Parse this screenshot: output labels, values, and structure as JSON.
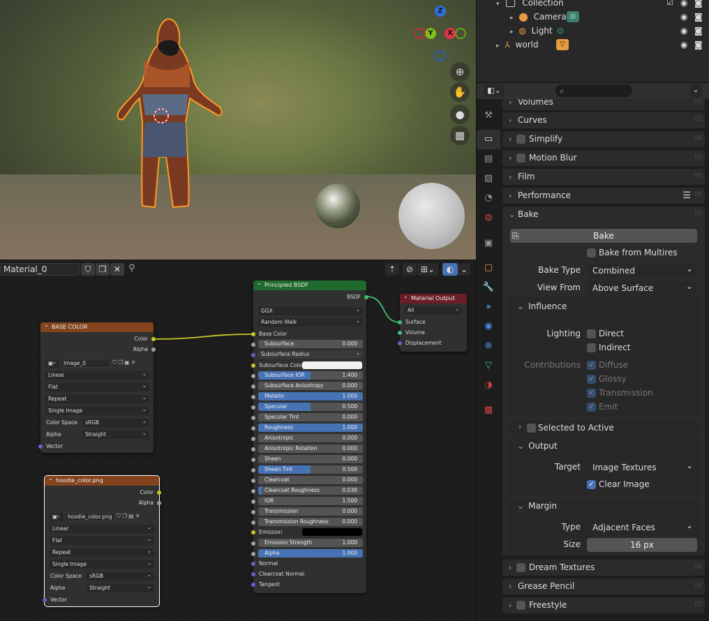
{
  "viewport": {
    "gizmo": {
      "z": "Z",
      "y": "Y",
      "x": "X"
    },
    "nav_icons": [
      "zoom-icon",
      "hand-icon",
      "camera-icon",
      "grid-icon"
    ]
  },
  "outliner": {
    "rows": [
      {
        "label": "Collection",
        "icon": "collection-icon"
      },
      {
        "label": "Camera",
        "icon": "camera-object-icon"
      },
      {
        "label": "Light",
        "icon": "light-object-icon"
      },
      {
        "label": "world",
        "icon": "world-object-icon"
      }
    ]
  },
  "node_editor": {
    "material_name": "Material_0",
    "nodes": {
      "base_color": {
        "title": "BASE COLOR",
        "out_color": "Color",
        "out_alpha": "Alpha",
        "image": "Image_0",
        "interp": "Linear",
        "proj": "Flat",
        "ext": "Repeat",
        "source": "Single Image",
        "cs_label": "Color Space",
        "cs_value": "sRGB",
        "alpha_label": "Alpha",
        "alpha_value": "Straight",
        "vector": "Vector"
      },
      "hoodie": {
        "title": "hoodie_color.png",
        "out_color": "Color",
        "out_alpha": "Alpha",
        "image": "hoodie_color.png",
        "interp": "Linear",
        "proj": "Flat",
        "ext": "Repeat",
        "source": "Single Image",
        "cs_label": "Color Space",
        "cs_value": "sRGB",
        "alpha_label": "Alpha",
        "alpha_value": "Straight",
        "vector": "Vector"
      },
      "bsdf": {
        "title": "Principled BSDF",
        "out": "BSDF",
        "dist": "GGX",
        "sss": "Random Walk",
        "base_color": "Base Color",
        "sliders": [
          {
            "label": "Subsurface",
            "value": "0.000",
            "fill": 0
          },
          {
            "label": "Subsurface IOR",
            "value": "1.400",
            "fill": 0.5
          },
          {
            "label": "Subsurface Anisotropy",
            "value": "0.000",
            "fill": 0
          },
          {
            "label": "Metallic",
            "value": "1.000",
            "fill": 1
          },
          {
            "label": "Specular",
            "value": "0.500",
            "fill": 0.5
          },
          {
            "label": "Specular Tint",
            "value": "0.000",
            "fill": 0
          },
          {
            "label": "Roughness",
            "value": "1.000",
            "fill": 1
          },
          {
            "label": "Anisotropic",
            "value": "0.000",
            "fill": 0
          },
          {
            "label": "Anisotropic Rotation",
            "value": "0.000",
            "fill": 0
          },
          {
            "label": "Sheen",
            "value": "0.000",
            "fill": 0
          },
          {
            "label": "Sheen Tint",
            "value": "0.500",
            "fill": 0.5
          },
          {
            "label": "Clearcoat",
            "value": "0.000",
            "fill": 0
          },
          {
            "label": "Clearcoat Roughness",
            "value": "0.030",
            "fill": 0.03
          },
          {
            "label": "IOR",
            "value": "1.500",
            "fill": 0
          },
          {
            "label": "Transmission",
            "value": "0.000",
            "fill": 0
          },
          {
            "label": "Transmission Roughness",
            "value": "0.000",
            "fill": 0
          },
          {
            "label": "Emission Strength",
            "value": "1.000",
            "fill": 0
          },
          {
            "label": "Alpha",
            "value": "1.000",
            "fill": 1
          }
        ],
        "subsurface_radius": "Subsurface Radius",
        "subsurface_color": "Subsurface Color",
        "emission": "Emission",
        "normal": "Normal",
        "clearcoat_normal": "Clearcoat Normal",
        "tangent": "Tangent"
      },
      "output": {
        "title": "Material Output",
        "target": "All",
        "surface": "Surface",
        "volume": "Volume",
        "displacement": "Displacement"
      }
    }
  },
  "properties": {
    "panels": {
      "volumes": "Volumes",
      "curves": "Curves",
      "simplify": "Simplify",
      "motion_blur": "Motion Blur",
      "film": "Film",
      "performance": "Performance",
      "bake": "Bake",
      "dream_textures": "Dream Textures",
      "grease_pencil": "Grease Pencil",
      "freestyle": "Freestyle"
    },
    "bake": {
      "button": "Bake",
      "from_multires": "Bake from Multires",
      "bake_type_label": "Bake Type",
      "bake_type": "Combined",
      "view_from_label": "View From",
      "view_from": "Above Surface",
      "influence": "Influence",
      "lighting_label": "Lighting",
      "direct": "Direct",
      "indirect": "Indirect",
      "contributions_label": "Contributions",
      "diffuse": "Diffuse",
      "glossy": "Glossy",
      "transmission": "Transmission",
      "emit": "Emit",
      "selected_to_active": "Selected to Active",
      "output": "Output",
      "target_label": "Target",
      "target": "Image Textures",
      "clear_image": "Clear Image",
      "margin": "Margin",
      "type_label": "Type",
      "type": "Adjacent Faces",
      "size_label": "Size",
      "size": "16 px"
    }
  }
}
